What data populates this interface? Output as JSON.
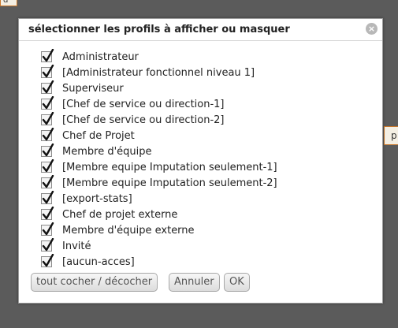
{
  "background": {
    "fragment_top": "d",
    "fragment_right": "p"
  },
  "dialog": {
    "title": "sélectionner les profils à afficher ou masquer",
    "close_icon": "×",
    "profiles": [
      {
        "label": "Administrateur",
        "checked": true
      },
      {
        "label": "[Administrateur fonctionnel niveau 1]",
        "checked": true
      },
      {
        "label": "Superviseur",
        "checked": true
      },
      {
        "label": "[Chef de service ou direction-1]",
        "checked": true
      },
      {
        "label": "[Chef de service ou direction-2]",
        "checked": true
      },
      {
        "label": "Chef de Projet",
        "checked": true
      },
      {
        "label": "Membre d'équipe",
        "checked": true
      },
      {
        "label": "[Membre equipe Imputation seulement-1]",
        "checked": true
      },
      {
        "label": "[Membre equipe Imputation seulement-2]",
        "checked": true
      },
      {
        "label": "[export-stats]",
        "checked": true
      },
      {
        "label": "Chef de projet externe",
        "checked": true
      },
      {
        "label": "Membre d'équipe externe",
        "checked": true
      },
      {
        "label": "Invité",
        "checked": true
      },
      {
        "label": "[aucun-acces]",
        "checked": true
      }
    ],
    "buttons": {
      "toggle_all": "tout cocher / décocher",
      "cancel": "Annuler",
      "ok": "OK"
    }
  }
}
